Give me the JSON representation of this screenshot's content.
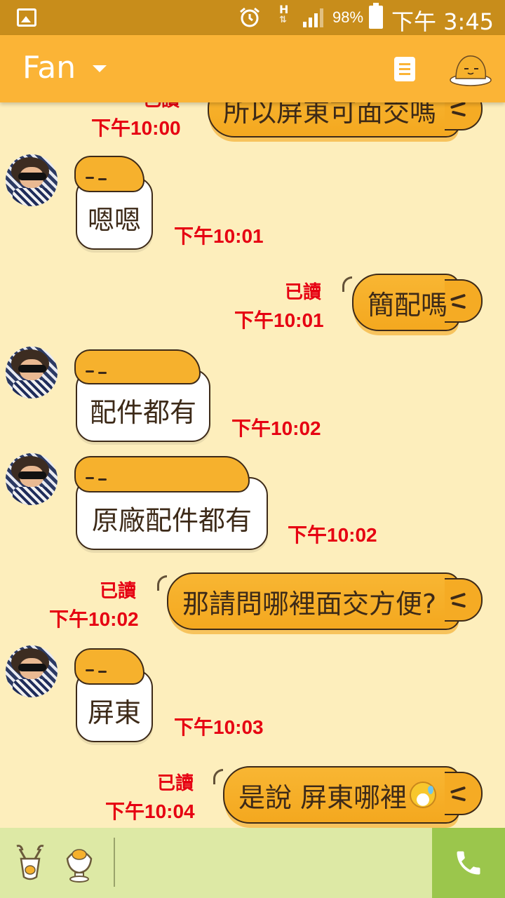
{
  "status_bar": {
    "network_type": "H",
    "battery_percent": "98%",
    "time": "下午 3:45"
  },
  "header": {
    "title": "Fan"
  },
  "messages": [
    {
      "dir": "out",
      "text": "所以屏東可面交嗎",
      "read": "已讀",
      "time": "下午10:00"
    },
    {
      "dir": "in",
      "text": "嗯嗯",
      "time": "下午10:01"
    },
    {
      "dir": "out",
      "text": "簡配嗎",
      "read": "已讀",
      "time": "下午10:01"
    },
    {
      "dir": "in",
      "text": "配件都有",
      "time": "下午10:02"
    },
    {
      "dir": "in",
      "text": "原廠配件都有",
      "time": "下午10:02"
    },
    {
      "dir": "out",
      "text": "那請問哪裡面交方便?",
      "read": "已讀",
      "time": "下午10:02"
    },
    {
      "dir": "in",
      "text": "屏東",
      "time": "下午10:03"
    },
    {
      "dir": "out",
      "text": "是說 屏東哪裡",
      "emoji": "sweat-smile-emoji",
      "read": "已讀",
      "time": "下午10:04"
    }
  ],
  "colors": {
    "header": "#fbb436",
    "statusbar": "#c88d1b",
    "chat_bg": "#fdeebc",
    "timestamp": "#e60012",
    "bottom_bar": "#dde9a5",
    "call_button": "#9bc64c"
  }
}
